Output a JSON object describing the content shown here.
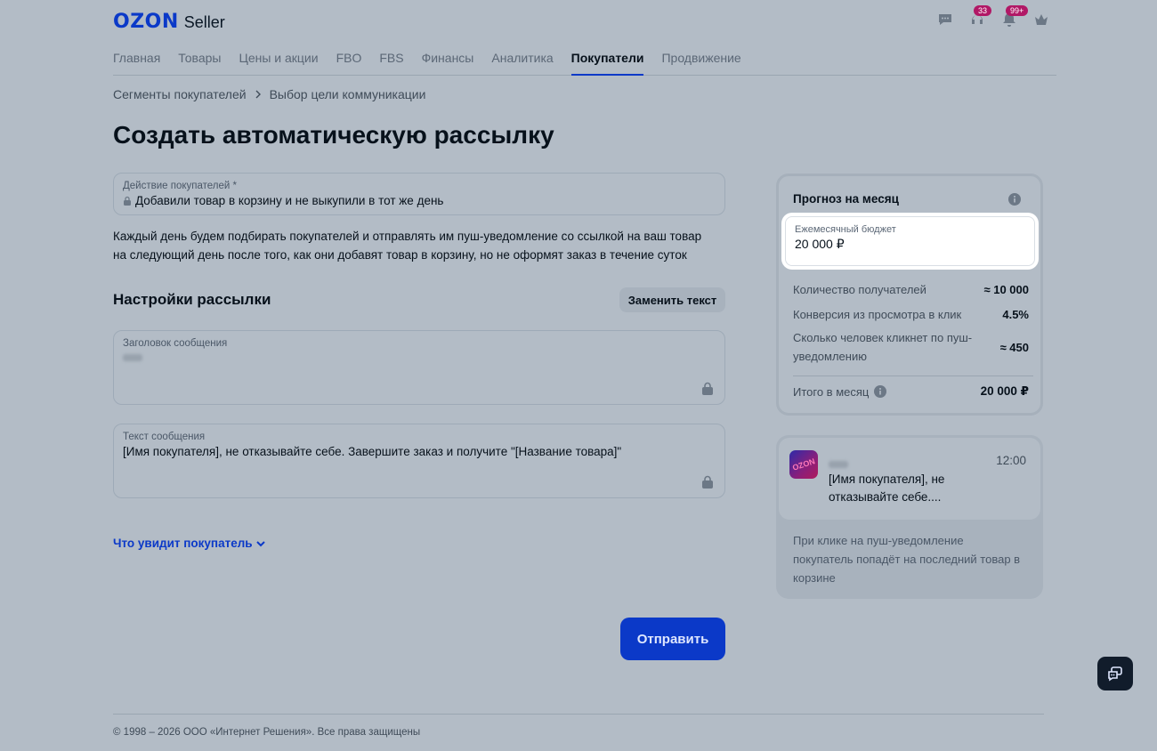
{
  "header": {
    "logo": "OZON",
    "logo_suffix": "Seller",
    "badges": {
      "support": "33",
      "notifications": "99+"
    }
  },
  "nav": {
    "items": [
      {
        "label": "Главная",
        "active": false
      },
      {
        "label": "Товары",
        "active": false
      },
      {
        "label": "Цены и акции",
        "active": false
      },
      {
        "label": "FBO",
        "active": false
      },
      {
        "label": "FBS",
        "active": false
      },
      {
        "label": "Финансы",
        "active": false
      },
      {
        "label": "Аналитика",
        "active": false
      },
      {
        "label": "Покупатели",
        "active": true
      },
      {
        "label": "Продвижение",
        "active": false
      }
    ]
  },
  "breadcrumb": {
    "parent": "Сегменты покупателей",
    "current": "Выбор цели коммуникации"
  },
  "page": {
    "title": "Создать автоматическую рассылку"
  },
  "action_field": {
    "label": "Действие покупателей *",
    "value": "Добавили товар в корзину и не выкупили в тот же день"
  },
  "description": {
    "line1": "Каждый день будем подбирать покупателей и отправлять им пуш-уведомление со ссылкой на ваш товар",
    "line2": "на следующий день после того, как они добавят товар в корзину, но не оформят заказ в течение суток"
  },
  "settings": {
    "title": "Настройки рассылки",
    "replace_button": "Заменить текст",
    "message_title_label": "Заголовок сообщения",
    "message_text_label": "Текст сообщения",
    "message_text_value": "[Имя покупателя], не отказывайте себе. Завершите заказ и получите \"[Название товара]\""
  },
  "viewer_link": "Что увидит покупатель",
  "send_button": "Отправить",
  "forecast": {
    "title": "Прогноз на месяц",
    "budget_label": "Ежемесячный бюджет",
    "budget_value": "20 000 ₽",
    "rows": [
      {
        "label": "Количество получателей",
        "value": "≈ 10 000"
      },
      {
        "label": "Конверсия из просмотра в клик",
        "value": "4.5%"
      },
      {
        "label": "Сколько человек кликнет по пуш-уведомлению",
        "value": "≈ 450"
      }
    ],
    "total_label": "Итого в месяц",
    "total_value": "20 000 ₽"
  },
  "preview": {
    "app_icon_text": "OZON",
    "time": "12:00",
    "text": "[Имя покупателя], не отказывайте себе....",
    "note": "При клике на пуш-уведомление покупатель попадёт на последний товар в корзине"
  },
  "footer": {
    "copyright": "© 1998 – 2026 ООО «Интернет Решения». Все права защищены"
  },
  "colors": {
    "accent": "#0b39c8",
    "badge": "#b11866",
    "overlay": "#b3bcc6"
  }
}
